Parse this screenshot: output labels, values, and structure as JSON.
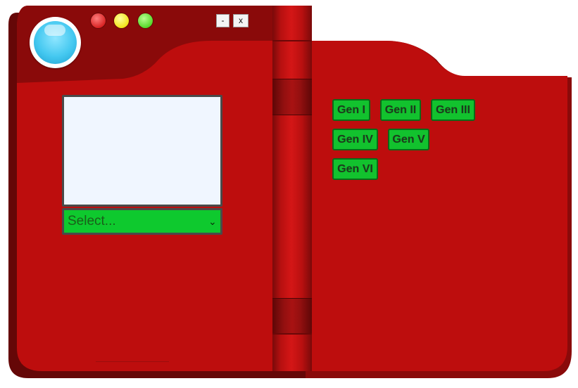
{
  "window_controls": {
    "minimize_label": "-",
    "close_label": "x"
  },
  "indicators": [
    "lens",
    "red-led",
    "yellow-led",
    "green-led"
  ],
  "colors": {
    "body_red": "#bd0d0d",
    "body_dark": "#8a0a0a",
    "button_green": "#12c22e",
    "screen_bg": "#f0f6ff",
    "lens_blue": "#44c8f0"
  },
  "dropdown": {
    "selected": "Select..."
  },
  "generations": [
    {
      "label": "Gen I"
    },
    {
      "label": "Gen II"
    },
    {
      "label": "Gen III"
    },
    {
      "label": "Gen IV"
    },
    {
      "label": "Gen V"
    },
    {
      "label": "Gen VI"
    }
  ]
}
